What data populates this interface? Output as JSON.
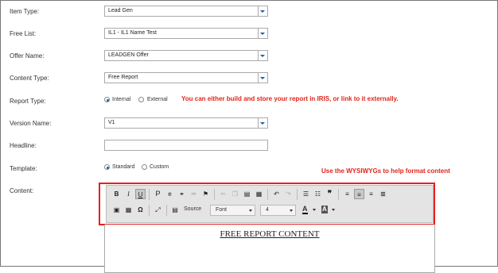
{
  "form": {
    "item_type": {
      "label": "Item Type:",
      "value": "Lead Gen"
    },
    "free_list": {
      "label": "Free List:",
      "value": "IL1 - IL1 Name Test"
    },
    "offer_name": {
      "label": "Offer Name:",
      "value": "LEADGEN Offer"
    },
    "content_type": {
      "label": "Content Type:",
      "value": "Free Report"
    },
    "report_type": {
      "label": "Report Type:",
      "options": [
        "Internal",
        "External"
      ],
      "selected": "Internal"
    },
    "version_name": {
      "label": "Version Name:",
      "value": "V1"
    },
    "headline": {
      "label": "Headline:",
      "value": ""
    },
    "template": {
      "label": "Template:",
      "options": [
        "Standard",
        "Custom"
      ],
      "selected": "Standard"
    },
    "content": {
      "label": "Content:"
    }
  },
  "notes": {
    "report_type": "You can either build and store your report in IRIS, or link to it externally.",
    "wysiwyg": "Use the WYSIWYGs to help format content"
  },
  "toolbar": {
    "source_label": "Source",
    "font_label": "Font",
    "size_value": "4",
    "text_color_label": "A",
    "bg_color_label": "A"
  },
  "editor": {
    "content": "FREE REPORT CONTENT"
  },
  "colors": {
    "annotation_red": "#e0241a",
    "accent_blue": "#1f5ca8"
  }
}
